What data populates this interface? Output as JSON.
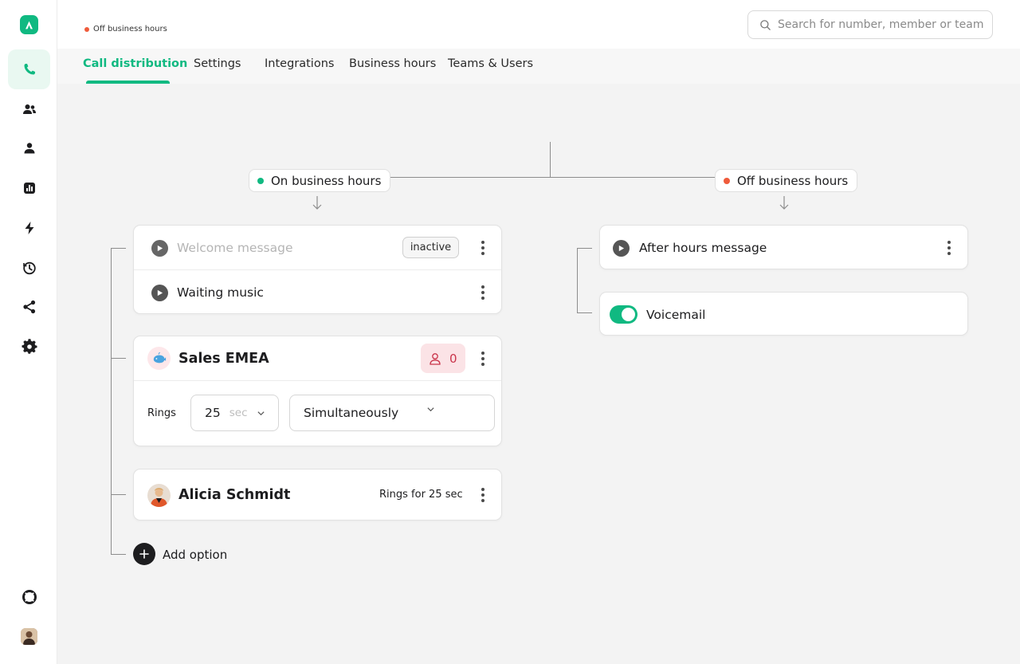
{
  "header": {
    "status_text": "Off business hours",
    "search_placeholder": "Search for number, member or team"
  },
  "tabs": [
    {
      "label": "Call distribution",
      "active": true
    },
    {
      "label": "Settings",
      "active": false
    },
    {
      "label": "Integrations",
      "active": false
    },
    {
      "label": "Business hours",
      "active": false
    },
    {
      "label": "Teams & Users",
      "active": false
    }
  ],
  "sidebar": {
    "items": [
      {
        "icon": "phone-icon",
        "active": true
      },
      {
        "icon": "team-icon",
        "active": false
      },
      {
        "icon": "user-icon",
        "active": false
      },
      {
        "icon": "analytics-icon",
        "active": false
      },
      {
        "icon": "lightning-icon",
        "active": false
      },
      {
        "icon": "history-icon",
        "active": false
      },
      {
        "icon": "share-icon",
        "active": false
      },
      {
        "icon": "gear-icon",
        "active": false
      }
    ],
    "bottom": [
      {
        "icon": "help-lifebuoy-icon"
      },
      {
        "icon": "user-avatar"
      }
    ]
  },
  "flow": {
    "on_hours": {
      "label": "On business hours",
      "welcome_message": {
        "label": "Welcome message",
        "status": "inactive"
      },
      "waiting_music": {
        "label": "Waiting music"
      },
      "team": {
        "name": "Sales EMEA",
        "member_count": "0",
        "rings_label": "Rings",
        "rings_value": "25",
        "rings_unit": "sec",
        "strategy": "Simultaneously"
      },
      "member": {
        "name": "Alicia Schmidt",
        "rings_text": "Rings for 25 sec"
      },
      "add_option_label": "Add option"
    },
    "off_hours": {
      "label": "Off business hours",
      "after_hours_message": {
        "label": "After hours message"
      },
      "voicemail": {
        "label": "Voicemail",
        "enabled": true
      }
    }
  },
  "colors": {
    "accent": "#10b981",
    "status_off": "#ef5b3b",
    "status_on": "#10b981",
    "badge_pink_bg": "#fbe3e6",
    "badge_pink_text": "#c9344a"
  }
}
